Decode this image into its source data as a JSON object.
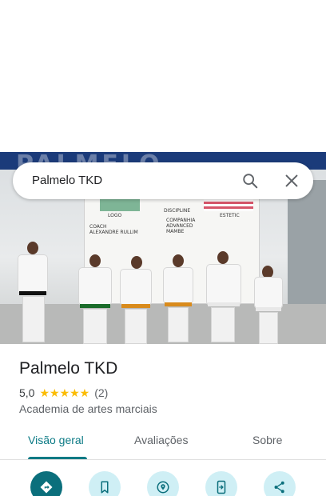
{
  "search": {
    "query": "Palmelo TKD"
  },
  "hero": {
    "banner_text": "PALMELO",
    "board_lines": [
      "LOGO",
      "DISCIPLINE",
      "ESTETIC",
      "COACH",
      "ALEXANDRE RULLIM",
      "COMPANHIA",
      "ADVANCED",
      "MAMBE"
    ]
  },
  "place": {
    "name": "Palmelo TKD",
    "rating": "5,0",
    "stars": "★★★★★",
    "review_count": "(2)",
    "category": "Academia de artes marciais"
  },
  "tabs": [
    {
      "label": "Visão geral",
      "active": true
    },
    {
      "label": "Avaliações",
      "active": false
    },
    {
      "label": "Sobre",
      "active": false
    }
  ],
  "actions": [
    {
      "icon": "directions-icon"
    },
    {
      "icon": "bookmark-icon"
    },
    {
      "icon": "nearby-icon"
    },
    {
      "icon": "send-to-phone-icon"
    },
    {
      "icon": "share-icon"
    }
  ],
  "colors": {
    "accent": "#0b7a85",
    "action_bg": "#cfeff5",
    "primary_action": "#0b6f7c",
    "stars": "#fbbc04"
  }
}
